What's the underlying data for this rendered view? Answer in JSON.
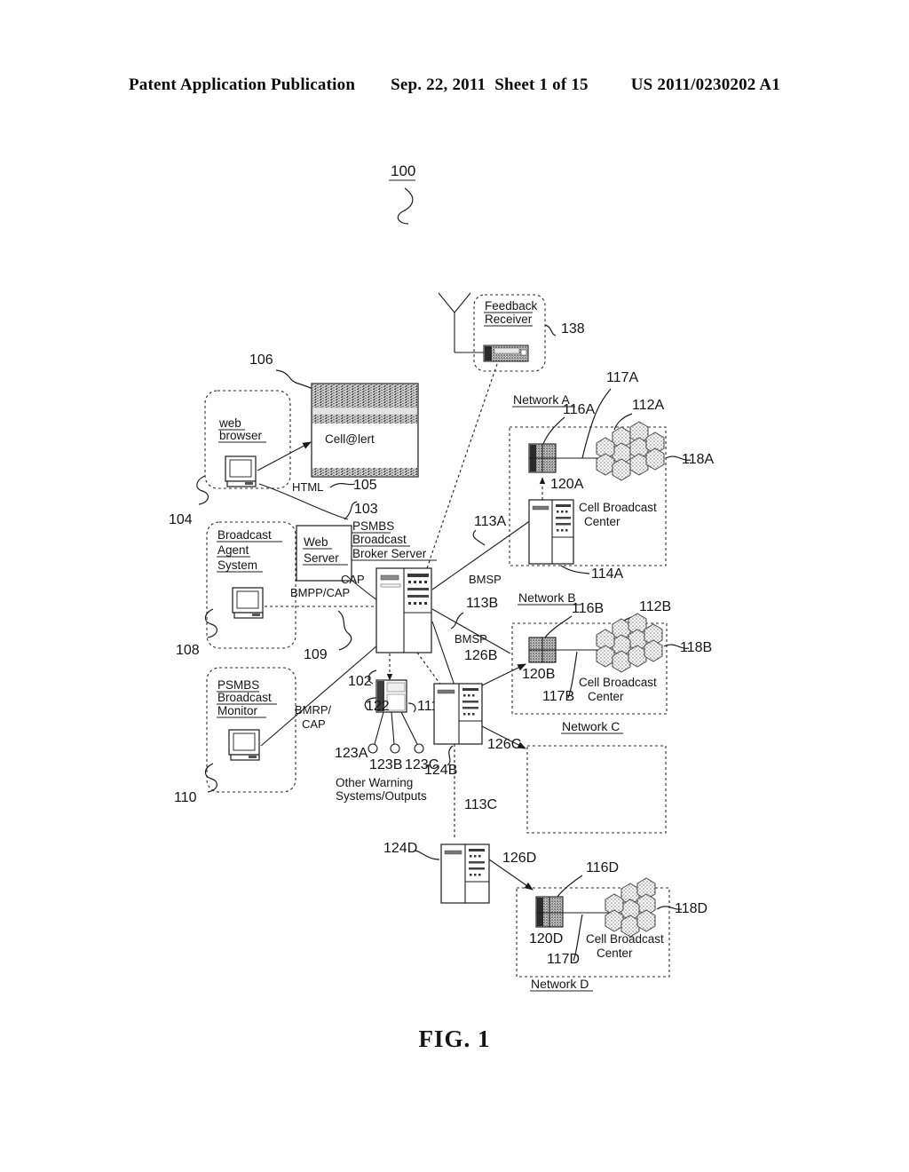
{
  "header": {
    "publication": "Patent Application Publication",
    "date": "Sep. 22, 2011",
    "sheet": "Sheet 1 of 15",
    "number": "US 2011/0230202 A1"
  },
  "figure": {
    "caption": "FIG. 1",
    "system_ref": "100",
    "nodes": {
      "feedback_receiver": {
        "label_line1": "Feedback",
        "label_line2": "Receiver",
        "ref": "138"
      },
      "browser_window": {
        "title_text": "Cell@lert",
        "ref": "106",
        "screen_ref": "105"
      },
      "web_browser_box": {
        "label_line1": "web",
        "label_line2": "browser",
        "ref": "104"
      },
      "broadcast_agent_system": {
        "label_line1": "Broadcast",
        "label_line2": "Agent",
        "label_line3": "System",
        "ref": "108"
      },
      "psmbs_broadcast_monitor": {
        "label_line1": "PSMBS",
        "label_line2": "Broadcast",
        "label_line3": "Monitor",
        "ref": "110"
      },
      "web_server": {
        "label_line1": "Web",
        "label_line2": "Server",
        "ref": "103"
      },
      "broker_server": {
        "label_line1": "PSMBS",
        "label_line2": "Broadcast",
        "label_line3": "Broker Server",
        "ref": "102"
      },
      "other_warning": {
        "label_line1": "Other Warning",
        "label_line2": "Systems/Outputs",
        "ref": "111",
        "sub_ref": "122",
        "outputs": [
          "123A",
          "123B",
          "123C"
        ]
      },
      "server_124b": {
        "ref": "124B"
      },
      "server_124d": {
        "ref": "124D"
      }
    },
    "protocols": {
      "html": "HTML",
      "cap": "CAP",
      "bmpp_cap": "BMPP/CAP",
      "bmrp_cap_line1": "BMRP/",
      "bmrp_cap_line2": "CAP",
      "bmsp_a": "BMSP",
      "bmsp_b": "BMSP"
    },
    "networks": [
      {
        "name": "Network A",
        "cbc_line1": "Cell Broadcast",
        "cbc_line2": "Center",
        "refs": {
          "box": "112A",
          "gateway": "116A",
          "link": "117A",
          "cells": "118A",
          "device": "120A",
          "server": "114A",
          "conn": "113A"
        }
      },
      {
        "name": "Network B",
        "cbc_line1": "Cell Broadcast",
        "cbc_line2": "Center",
        "refs": {
          "box": "112B",
          "gateway": "116B",
          "link": "117B",
          "cells": "118B",
          "device": "120B",
          "conn": "113B",
          "arrow": "126B"
        }
      },
      {
        "name": "Network C",
        "cbc_line1": "",
        "cbc_line2": "",
        "refs": {
          "conn": "113C",
          "arrow": "126C"
        }
      },
      {
        "name": "Network D",
        "cbc_line1": "Cell Broadcast",
        "cbc_line2": "Center",
        "refs": {
          "gateway": "116D",
          "link": "117D",
          "cells": "118D",
          "device": "120D",
          "arrow": "126D"
        }
      }
    ]
  }
}
